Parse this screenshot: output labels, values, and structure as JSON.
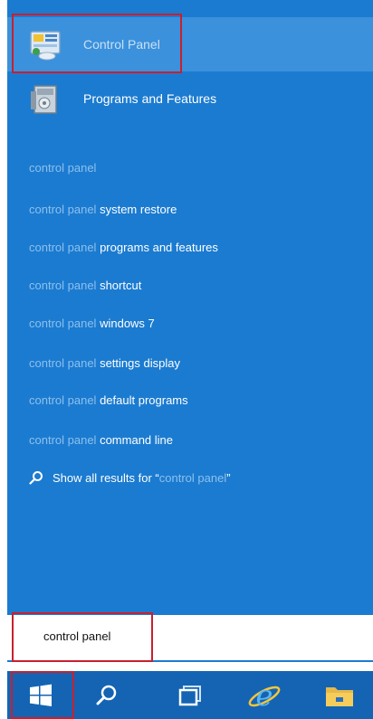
{
  "results": {
    "apps": [
      {
        "label": "Control Panel",
        "icon": "control-panel-icon",
        "selected": true
      },
      {
        "label": "Programs and Features",
        "icon": "programs-features-icon",
        "selected": false
      }
    ],
    "suggestions": [
      {
        "query": "control panel",
        "rest": ""
      },
      {
        "query": "control panel",
        "rest": "system restore"
      },
      {
        "query": "control panel",
        "rest": "programs and features"
      },
      {
        "query": "control panel",
        "rest": "shortcut"
      },
      {
        "query": "control panel",
        "rest": "windows 7"
      },
      {
        "query": "control panel",
        "rest": "settings display"
      },
      {
        "query": "control panel",
        "rest": "default programs"
      },
      {
        "query": "control panel",
        "rest": "command line"
      }
    ],
    "show_all": {
      "prefix": "Show all results for “",
      "query": "control panel",
      "suffix": "”"
    }
  },
  "search": {
    "value": "control panel"
  },
  "taskbar": {
    "items": [
      "windows-start-icon",
      "search-icon",
      "task-view-icon",
      "internet-explorer-icon",
      "file-explorer-icon"
    ]
  },
  "colors": {
    "panel": "#1b7bd0",
    "selected": "#3b91dc",
    "taskbar": "#1464b3",
    "highlight": "#c8202f"
  }
}
